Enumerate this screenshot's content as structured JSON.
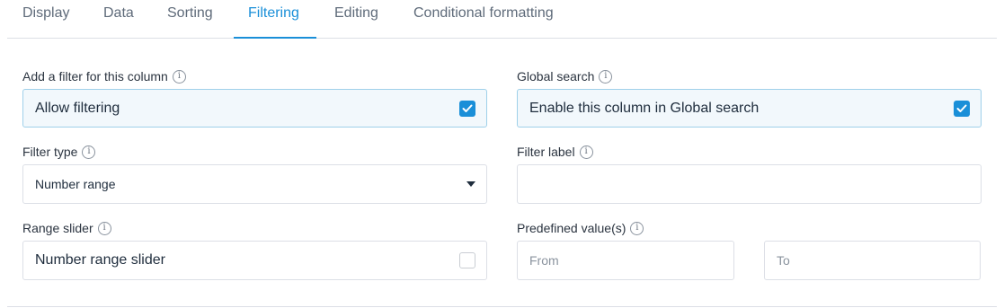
{
  "tabs": [
    {
      "label": "Display"
    },
    {
      "label": "Data"
    },
    {
      "label": "Sorting"
    },
    {
      "label": "Filtering"
    },
    {
      "label": "Editing"
    },
    {
      "label": "Conditional formatting"
    }
  ],
  "active_tab": "Filtering",
  "accent_color": "#1a8fd8",
  "fields": {
    "add_filter": {
      "label": "Add a filter for this column",
      "option_text": "Allow filtering",
      "checked": true
    },
    "global_search": {
      "label": "Global search",
      "option_text": "Enable this column in Global search",
      "checked": true
    },
    "filter_type": {
      "label": "Filter type",
      "selected": "Number range"
    },
    "filter_label": {
      "label": "Filter label",
      "value": ""
    },
    "range_slider": {
      "label": "Range slider",
      "option_text": "Number range slider",
      "checked": false
    },
    "predefined_values": {
      "label": "Predefined value(s)",
      "from_placeholder": "From",
      "to_placeholder": "To"
    }
  },
  "icons": {
    "info": "info-icon",
    "check": "check-icon",
    "caret": "caret-down-icon"
  }
}
